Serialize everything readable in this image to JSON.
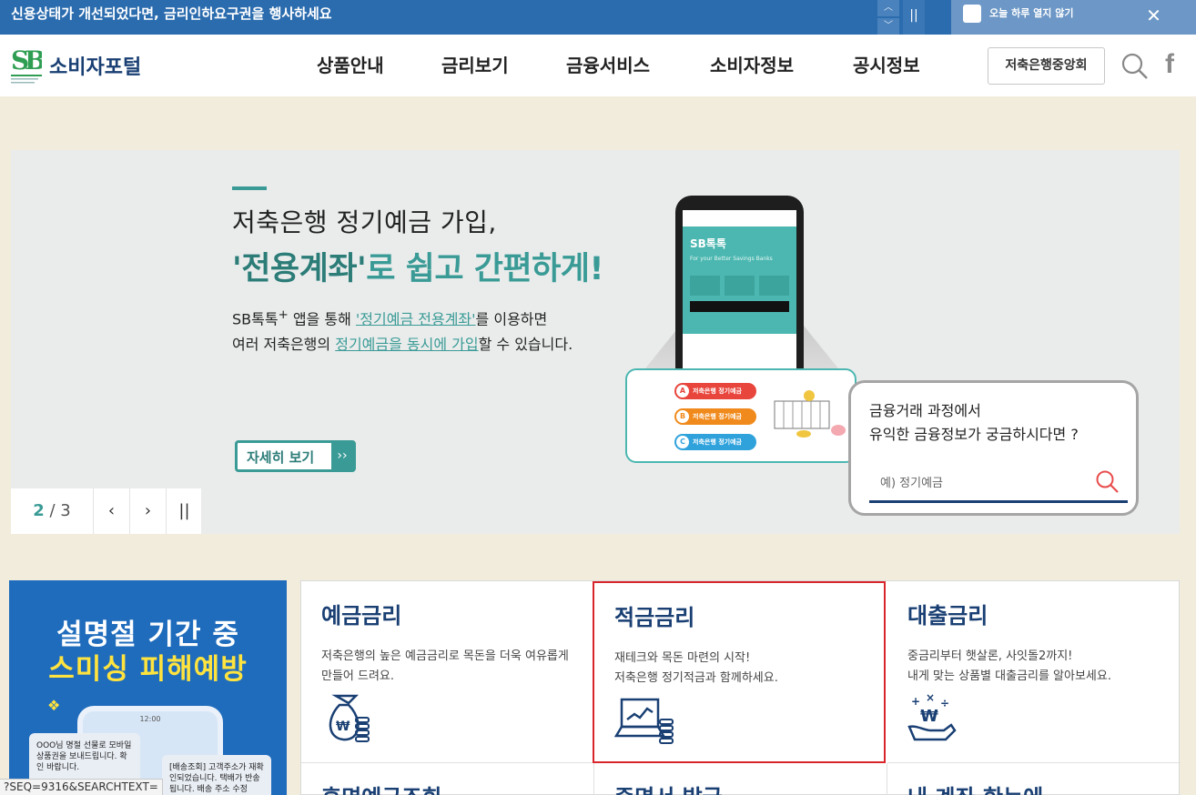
{
  "notice": {
    "message": "신용상태가 개선되었다면, 금리인하요구권을 행사하세요",
    "dont_show_today": "오늘 하루 열지 않기"
  },
  "header": {
    "logo_text": "소비자포털",
    "nav": [
      "상품안내",
      "금리보기",
      "금융서비스",
      "소비자정보",
      "공시정보"
    ],
    "federation_button": "저축은행중앙회"
  },
  "hero": {
    "title_line1": "저축은행 정기예금 가입,",
    "title_line2_highlight": "'전용계좌'",
    "title_line2_rest": "로 쉽고 간편하게!",
    "desc_line1_prefix": "SB톡톡",
    "desc_line1_sup": "+",
    "desc_line1_mid": " 앱을 통해 ",
    "desc_line1_link": "'정기예금 전용계좌'",
    "desc_line1_suffix": "를 이용하면",
    "desc_line2_prefix": "여러 저축은행의 ",
    "desc_line2_link": "정기예금을 동시에 가입",
    "desc_line2_suffix": "할 수 있습니다.",
    "more_button": "자세히 보기",
    "more_arrow": "››",
    "pager_current": "2",
    "pager_total": "3",
    "phone_app_name": "SB톡톡",
    "phone_tagline": "For your Better Savings Banks",
    "flow_items": [
      {
        "key": "A",
        "label": "저축은행 정기예금",
        "color": "#e8453c"
      },
      {
        "key": "B",
        "label": "저축은행 정기예금",
        "color": "#f08a1c"
      },
      {
        "key": "C",
        "label": "저축은행 정기예금",
        "color": "#2fa2dc"
      }
    ]
  },
  "search_panel": {
    "question_line1": "금융거래 과정에서",
    "question_line2": "유익한 금융정보가 궁금하시다면 ?",
    "placeholder": "예) 정기예금"
  },
  "promo": {
    "line1": "설명절 기간 중",
    "line2": "스미싱 피해예방",
    "phone_time": "12:00",
    "bubble1": "OOO님 명절 선물로 모바일 상품권을 보내드립니다. 확인 바랍니다.",
    "bubble2": "[배송조회] 고객주소가 재확인되었습니다. 택배가 반송 됩니다. 배송 주소 수정"
  },
  "rate_cards": [
    {
      "title": "예금금리",
      "desc_line1": "저축은행의 높은 예금금리로 목돈을 더욱 여유롭게",
      "desc_line2": "만들어 드려요.",
      "icon": "money-bag-icon"
    },
    {
      "title": "적금금리",
      "desc_line1": "재테크와 목돈 마련의 시작!",
      "desc_line2": "저축은행 정기적금과 함께하세요.",
      "icon": "laptop-coins-icon"
    },
    {
      "title": "대출금리",
      "desc_line1": "중금리부터 햇살론, 사잇돌2까지!",
      "desc_line2": "내게 맞는 상품별 대출금리를 알아보세요.",
      "icon": "hand-won-icon"
    }
  ],
  "lower_cards": [
    "휴면예금조회",
    "증명서 발급",
    "내 계좌 한눈에"
  ],
  "status_url": "?SEQ=9316&SEARCHTEXT=",
  "colors": {
    "brand_navy": "#193f73",
    "teal": "#3a9b96",
    "notice_blue": "#2b6cae",
    "selected_border": "#d9262c"
  }
}
